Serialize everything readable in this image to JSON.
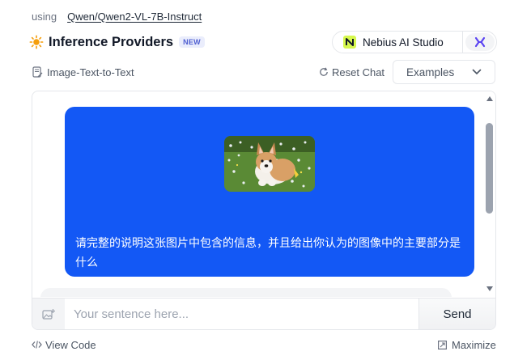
{
  "header": {
    "using_label": "using",
    "model_name": "Qwen/Qwen2-VL-7B-Instruct",
    "title": "Inference Providers",
    "badge": "NEW",
    "title_icon": "sun-icon"
  },
  "provider": {
    "name": "Nebius AI Studio",
    "icon": "nebius-icon",
    "alt_icon": "hf-icon",
    "accent": "#d6f84e"
  },
  "toolbar": {
    "task": "Image-Text-to-Text",
    "reset": "Reset Chat",
    "examples": "Examples"
  },
  "chat": {
    "messages": [
      {
        "role": "user",
        "has_image": true,
        "image": "corgi-puppy-photo",
        "text": "请完整的说明这张图片中包含的信息，并且给出你认为的图像中的主要部分是什么"
      }
    ],
    "bubble_color": "#1358f5"
  },
  "input": {
    "placeholder": "Your sentence here...",
    "value": "",
    "send_label": "Send"
  },
  "footer": {
    "view_code": "View Code",
    "maximize": "Maximize"
  }
}
